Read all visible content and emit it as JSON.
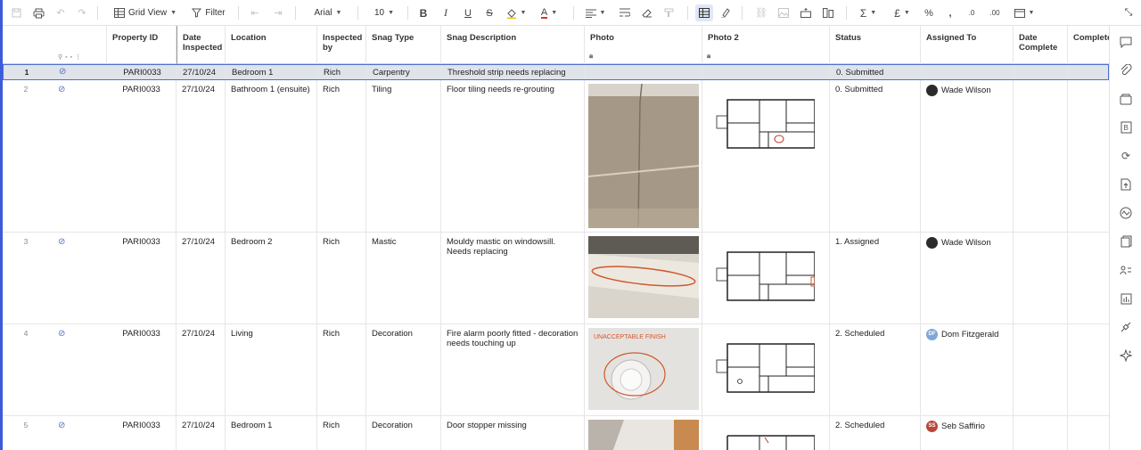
{
  "toolbar": {
    "view_label": "Grid View",
    "filter_label": "Filter",
    "font_name": "Arial",
    "font_size": "10"
  },
  "columns": [
    {
      "key": "property_id",
      "label": "Property ID"
    },
    {
      "key": "date_inspected",
      "label": "Date Inspected"
    },
    {
      "key": "location",
      "label": "Location"
    },
    {
      "key": "inspected_by",
      "label": "Inspected by"
    },
    {
      "key": "snag_type",
      "label": "Snag Type"
    },
    {
      "key": "snag_description",
      "label": "Snag Description"
    },
    {
      "key": "photo",
      "label": "Photo"
    },
    {
      "key": "photo2",
      "label": "Photo 2"
    },
    {
      "key": "status",
      "label": "Status"
    },
    {
      "key": "assigned_to",
      "label": "Assigned To"
    },
    {
      "key": "date_complete",
      "label": "Date Complete"
    },
    {
      "key": "complete",
      "label": "Complete"
    }
  ],
  "rows": [
    {
      "num": "1",
      "property_id": "PARI0033",
      "date": "27/10/24",
      "location": "Bedroom 1",
      "inspected_by": "Rich",
      "snag_type": "Carpentry",
      "description": "Threshold strip needs replacing",
      "status": "0. Submitted",
      "assignee": "",
      "assignee_initials": ""
    },
    {
      "num": "2",
      "property_id": "PARI0033",
      "date": "27/10/24",
      "location": "Bathroom 1 (ensuite)",
      "inspected_by": "Rich",
      "snag_type": "Tiling",
      "description": "Floor tiling needs re-grouting",
      "status": "0. Submitted",
      "assignee": "Wade Wilson",
      "assignee_initials": ""
    },
    {
      "num": "3",
      "property_id": "PARI0033",
      "date": "27/10/24",
      "location": "Bedroom 2",
      "inspected_by": "Rich",
      "snag_type": "Mastic",
      "description": "Mouldy mastic on windowsill. Needs replacing",
      "status": "1. Assigned",
      "assignee": "Wade Wilson",
      "assignee_initials": ""
    },
    {
      "num": "4",
      "property_id": "PARI0033",
      "date": "27/10/24",
      "location": "Living",
      "inspected_by": "Rich",
      "snag_type": "Decoration",
      "description": "Fire alarm poorly fitted - decoration needs touching up",
      "status": "2. Scheduled",
      "assignee": "Dom Fitzgerald",
      "assignee_initials": "DF"
    },
    {
      "num": "5",
      "property_id": "PARI0033",
      "date": "27/10/24",
      "location": "Bedroom 1",
      "inspected_by": "Rich",
      "snag_type": "Decoration",
      "description": "Door stopper missing",
      "status": "2. Scheduled",
      "assignee": "Seb Saffirio",
      "assignee_initials": "SS"
    }
  ],
  "photo_annotation": "UNACCEPTABLE FINISH",
  "colors": {
    "accent": "#4d6fd1",
    "selected_row": "#dfe3ea",
    "df_avatar": "#7fa6d6",
    "ss_avatar": "#b8483c"
  }
}
